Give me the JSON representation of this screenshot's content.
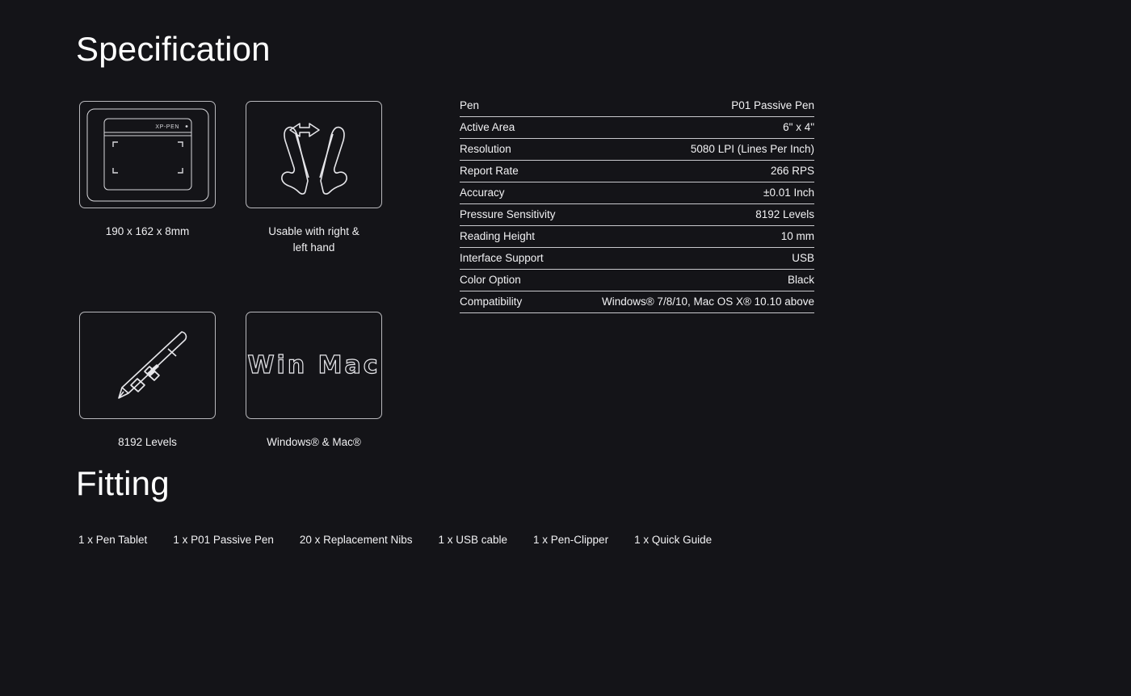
{
  "theme": {
    "background": "#141418",
    "text": "#f2f2f4",
    "line": "#c9c9cd",
    "icon_stroke": "#e6e6ea"
  },
  "sections": {
    "specification_heading": "Specification",
    "fitting_heading": "Fitting"
  },
  "features": [
    {
      "icon": "tablet-icon",
      "logo_text": "XP-PEN",
      "caption": "190 x 162 x 8mm"
    },
    {
      "icon": "two-hands-arrow-icon",
      "caption": "Usable with right &\nleft hand"
    },
    {
      "icon": "stylus-pen-icon",
      "caption": "8192 Levels"
    },
    {
      "icon": "win-mac-icon",
      "icon_text": "Win Mac",
      "caption": "Windows® & Mac®"
    }
  ],
  "spec_table": {
    "rows": [
      {
        "label": "Pen",
        "value": "P01 Passive Pen"
      },
      {
        "label": "Active Area",
        "value": "6\" x 4\""
      },
      {
        "label": "Resolution",
        "value": "5080 LPI (Lines Per Inch)"
      },
      {
        "label": "Report Rate",
        "value": "266 RPS"
      },
      {
        "label": "Accuracy",
        "value": "±0.01 Inch"
      },
      {
        "label": "Pressure Sensitivity",
        "value": "8192 Levels"
      },
      {
        "label": "Reading Height",
        "value": "10 mm"
      },
      {
        "label": "Interface Support",
        "value": "USB"
      },
      {
        "label": "Color Option",
        "value": "Black"
      },
      {
        "label": "Compatibility",
        "value": "Windows® 7/8/10, Mac OS X® 10.10 above"
      }
    ]
  },
  "fitting": {
    "items": [
      "1 x Pen Tablet",
      "1 x P01 Passive Pen",
      "20 x Replacement Nibs",
      "1 x USB cable",
      "1 x Pen-Clipper",
      "1 x Quick Guide"
    ]
  }
}
